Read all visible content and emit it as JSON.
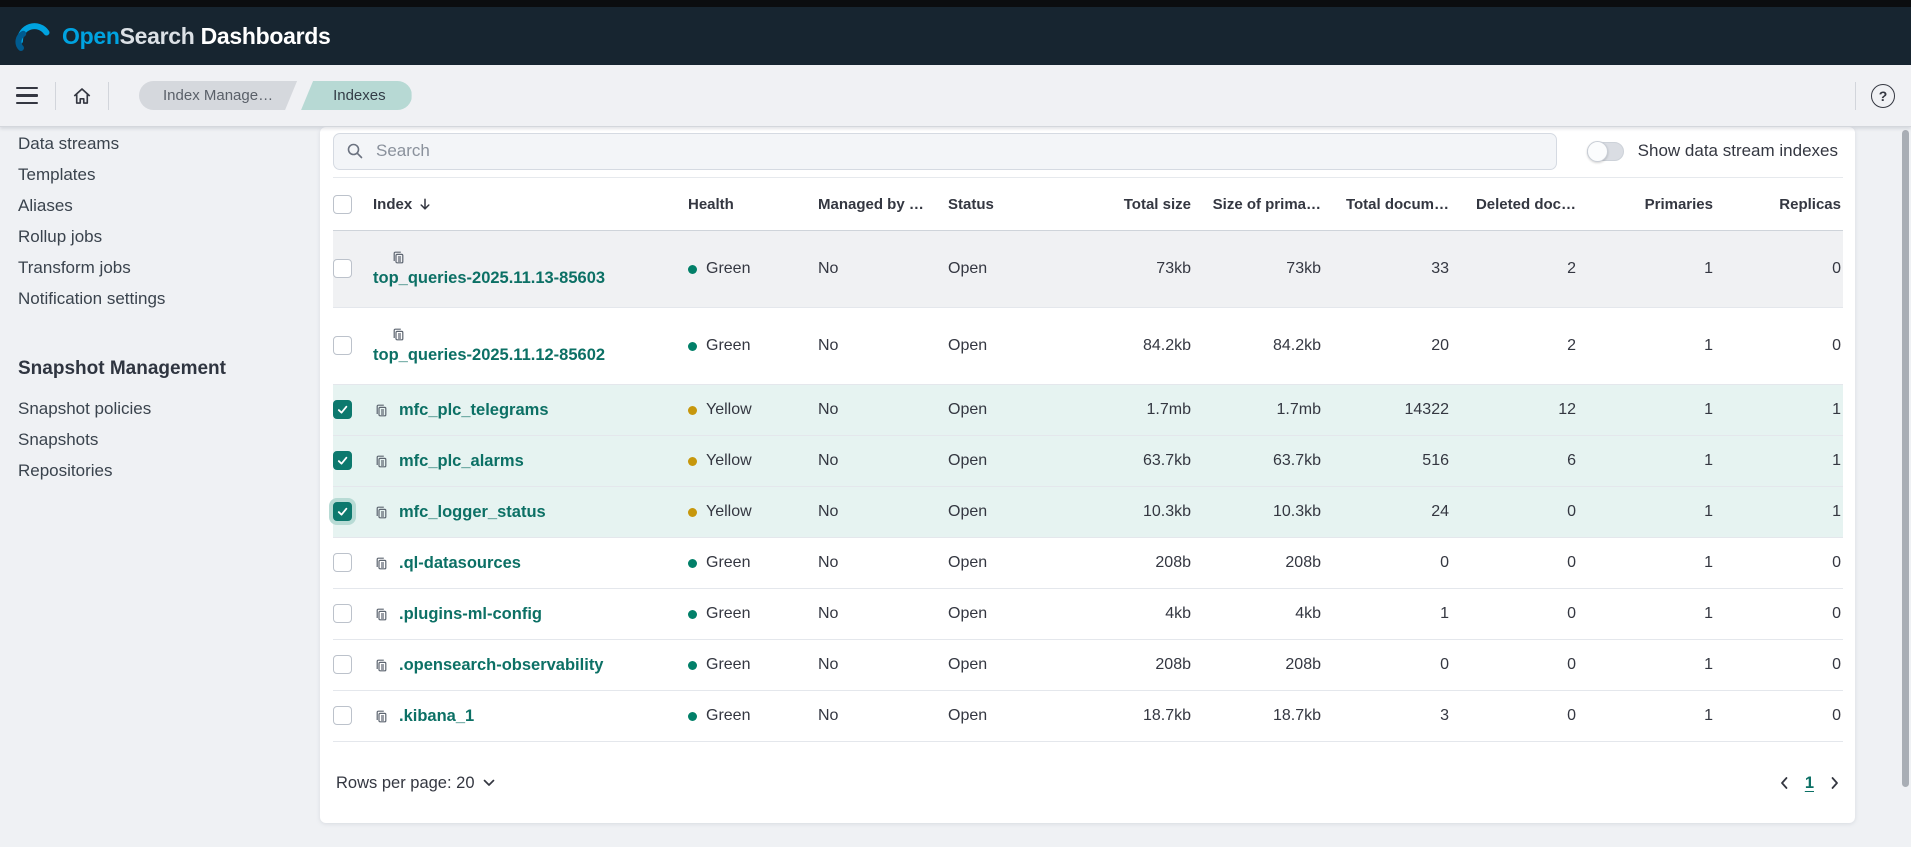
{
  "app": {
    "logo": {
      "open": "Open",
      "search": "Search",
      "dashboards": " Dashboards"
    }
  },
  "nav": {
    "breadcrumbs": [
      {
        "label": "Index Manage…"
      },
      {
        "label": "Indexes"
      }
    ],
    "help_glyph": "?"
  },
  "sidebar": {
    "items": [
      {
        "label": "Data streams"
      },
      {
        "label": "Templates"
      },
      {
        "label": "Aliases"
      },
      {
        "label": "Rollup jobs"
      },
      {
        "label": "Transform jobs"
      },
      {
        "label": "Notification settings"
      }
    ],
    "section": {
      "title": "Snapshot Management",
      "items": [
        {
          "label": "Snapshot policies"
        },
        {
          "label": "Snapshots"
        },
        {
          "label": "Repositories"
        }
      ]
    }
  },
  "controls": {
    "search_placeholder": "Search",
    "toggle_label": "Show data stream indexes",
    "toggle_state": "off"
  },
  "table": {
    "columns": [
      "Index",
      "Health",
      "Managed by …",
      "Status",
      "Total size",
      "Size of prima…",
      "Total docum…",
      "Deleted doc…",
      "Primaries",
      "Replicas"
    ],
    "sorted_column": "Index",
    "sort_direction": "down",
    "rows": [
      {
        "name": "top_queries-2025.11.13-85603",
        "health": "Green",
        "managed": "No",
        "status": "Open",
        "total_size": "73kb",
        "primary_size": "73kb",
        "total_docs": "33",
        "deleted_docs": "2",
        "primaries": "1",
        "replicas": "0",
        "selected": false,
        "two_line": true,
        "hovered": true,
        "focused": false
      },
      {
        "name": "top_queries-2025.11.12-85602",
        "health": "Green",
        "managed": "No",
        "status": "Open",
        "total_size": "84.2kb",
        "primary_size": "84.2kb",
        "total_docs": "20",
        "deleted_docs": "2",
        "primaries": "1",
        "replicas": "0",
        "selected": false,
        "two_line": true,
        "hovered": false,
        "focused": false
      },
      {
        "name": "mfc_plc_telegrams",
        "health": "Yellow",
        "managed": "No",
        "status": "Open",
        "total_size": "1.7mb",
        "primary_size": "1.7mb",
        "total_docs": "14322",
        "deleted_docs": "12",
        "primaries": "1",
        "replicas": "1",
        "selected": true,
        "two_line": false,
        "hovered": false,
        "focused": false
      },
      {
        "name": "mfc_plc_alarms",
        "health": "Yellow",
        "managed": "No",
        "status": "Open",
        "total_size": "63.7kb",
        "primary_size": "63.7kb",
        "total_docs": "516",
        "deleted_docs": "6",
        "primaries": "1",
        "replicas": "1",
        "selected": true,
        "two_line": false,
        "hovered": false,
        "focused": false
      },
      {
        "name": "mfc_logger_status",
        "health": "Yellow",
        "managed": "No",
        "status": "Open",
        "total_size": "10.3kb",
        "primary_size": "10.3kb",
        "total_docs": "24",
        "deleted_docs": "0",
        "primaries": "1",
        "replicas": "1",
        "selected": true,
        "two_line": false,
        "hovered": false,
        "focused": true
      },
      {
        "name": ".ql-datasources",
        "health": "Green",
        "managed": "No",
        "status": "Open",
        "total_size": "208b",
        "primary_size": "208b",
        "total_docs": "0",
        "deleted_docs": "0",
        "primaries": "1",
        "replicas": "0",
        "selected": false,
        "two_line": false,
        "hovered": false,
        "focused": false
      },
      {
        "name": ".plugins-ml-config",
        "health": "Green",
        "managed": "No",
        "status": "Open",
        "total_size": "4kb",
        "primary_size": "4kb",
        "total_docs": "1",
        "deleted_docs": "0",
        "primaries": "1",
        "replicas": "0",
        "selected": false,
        "two_line": false,
        "hovered": false,
        "focused": false
      },
      {
        "name": ".opensearch-observability",
        "health": "Green",
        "managed": "No",
        "status": "Open",
        "total_size": "208b",
        "primary_size": "208b",
        "total_docs": "0",
        "deleted_docs": "0",
        "primaries": "1",
        "replicas": "0",
        "selected": false,
        "two_line": false,
        "hovered": false,
        "focused": false
      },
      {
        "name": ".kibana_1",
        "health": "Green",
        "managed": "No",
        "status": "Open",
        "total_size": "18.7kb",
        "primary_size": "18.7kb",
        "total_docs": "3",
        "deleted_docs": "0",
        "primaries": "1",
        "replicas": "0",
        "selected": false,
        "two_line": false,
        "hovered": false,
        "focused": false
      }
    ]
  },
  "pagination": {
    "rows_per_page_label": "Rows per page: 20",
    "current_page": "1"
  },
  "colors": {
    "accent_teal": "#0d796e",
    "link_teal": "#0c7065",
    "health_green": "#028069",
    "health_yellow": "#c7970c",
    "selected_row_bg": "#e6f3f1",
    "header_bg": "#172530",
    "logo_blue": "#00a3e0",
    "breadcrumb_current_bg": "#b7d9d4"
  }
}
